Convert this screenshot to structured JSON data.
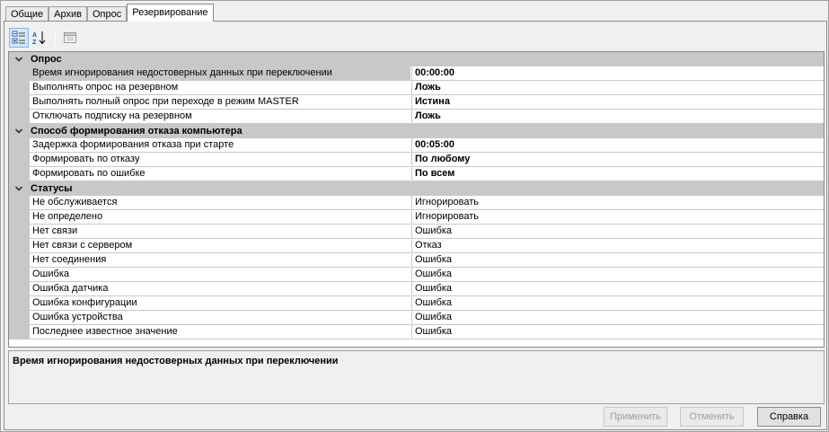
{
  "tabs": [
    {
      "label": "Общие"
    },
    {
      "label": "Архив"
    },
    {
      "label": "Опрос"
    },
    {
      "label": "Резервирование"
    }
  ],
  "categories": {
    "opros": "Опрос",
    "sposob": "Способ формирования отказа компьютера",
    "statusy": "Статусы"
  },
  "rows": {
    "r1": {
      "name": "Время игнорирования недостоверных данных при переключении",
      "value": "00:00:00"
    },
    "r2": {
      "name": "Выполнять опрос на резервном",
      "value": "Ложь"
    },
    "r3": {
      "name": "Выполнять полный опрос при переходе в режим MASTER",
      "value": "Истина"
    },
    "r4": {
      "name": "Отключать подписку на резервном",
      "value": "Ложь"
    },
    "r5": {
      "name": "Задержка формирования отказа при старте",
      "value": "00:05:00"
    },
    "r6": {
      "name": "Формировать по отказу",
      "value": "По любому"
    },
    "r7": {
      "name": "Формировать по ошибке",
      "value": "По всем"
    },
    "s1": {
      "name": "Не обслуживается",
      "value": "Игнорировать"
    },
    "s2": {
      "name": "Не определено",
      "value": "Игнорировать"
    },
    "s3": {
      "name": "Нет связи",
      "value": "Ошибка"
    },
    "s4": {
      "name": "Нет связи с сервером",
      "value": "Отказ"
    },
    "s5": {
      "name": "Нет соединения",
      "value": "Ошибка"
    },
    "s6": {
      "name": "Ошибка",
      "value": "Ошибка"
    },
    "s7": {
      "name": "Ошибка датчика",
      "value": "Ошибка"
    },
    "s8": {
      "name": "Ошибка конфигурации",
      "value": "Ошибка"
    },
    "s9": {
      "name": "Ошибка устройства",
      "value": "Ошибка"
    },
    "s10": {
      "name": "Последнее известное значение",
      "value": "Ошибка"
    }
  },
  "description": {
    "title": "Время игнорирования недостоверных данных при переключении"
  },
  "buttons": {
    "apply": "Применить",
    "cancel": "Отменить",
    "help": "Справка"
  },
  "toolbar": {
    "categorized_icon": "categorized-icon",
    "alphabetical_icon": "sort-az-icon",
    "property_pages_icon": "property-pages-icon"
  }
}
